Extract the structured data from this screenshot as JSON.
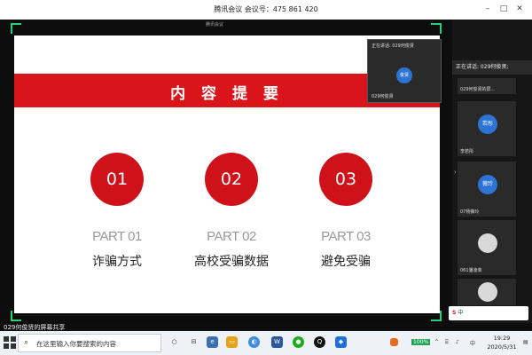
{
  "window": {
    "title": "腾讯会议 会议号：475 861 420"
  },
  "stage": {
    "top_label": "腾讯会议"
  },
  "slide": {
    "heading": "内 容 提 要",
    "items": [
      {
        "num": "01",
        "part": "PART 01",
        "title": "诈骗方式"
      },
      {
        "num": "02",
        "part": "PART 02",
        "title": "高校受骗数据"
      },
      {
        "num": "03",
        "part": "PART 03",
        "title": "避免受骗"
      }
    ]
  },
  "speaker_overlay": {
    "header": "正在讲话: 029何俊贤",
    "avatar": "俊贤",
    "footer": "029何俊贤"
  },
  "sidebar": {
    "now_speaking": "正在讲话: 029何俊贤;",
    "participants": [
      {
        "avatar": "",
        "name": "029何俊贤的屏…"
      },
      {
        "avatar": "若彤",
        "name": "李若彤"
      },
      {
        "avatar": "薇玲",
        "name": "07杨薇玲"
      },
      {
        "avatar": "",
        "name": "061潘凌菲"
      },
      {
        "avatar": "",
        "name": ""
      }
    ]
  },
  "bottom": {
    "share_label": "029何俊贤的屏幕共享"
  },
  "ime": {
    "logo": "S",
    "label": "中"
  },
  "taskbar": {
    "search_placeholder": "在这里输入你要搜索的内容",
    "battery": "100%",
    "time": "19:29",
    "date": "2020/5/31"
  },
  "colors": {
    "accent_red": "#d9141b",
    "green_border": "#27d17a",
    "blue_avatar": "#2d74d6"
  }
}
